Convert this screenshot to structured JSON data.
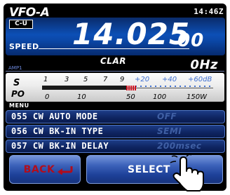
{
  "header": {
    "vfo_label": "VFO-A",
    "time": "14:46Z",
    "mode": "C-U",
    "speed_label": "SPEED",
    "frequency_main": "14.025",
    "frequency_small": "00"
  },
  "clar": {
    "label": "CLAR",
    "amp_label": "AMP1",
    "value": "0Hz"
  },
  "meter": {
    "s_label": "S",
    "po_label": "PO",
    "s_scale": [
      "1",
      "3",
      "5",
      "7",
      "9"
    ],
    "s_scale_over": [
      "+20",
      "+40",
      "+60dB"
    ],
    "po_scale": [
      "0",
      "10",
      "50",
      "100",
      "150W"
    ],
    "level_fraction": 0.55
  },
  "menu": {
    "label": "MENU",
    "items": [
      {
        "name": "055 CW AUTO MODE",
        "value": "OFF"
      },
      {
        "name": "056 CW BK-IN TYPE",
        "value": "SEMI"
      },
      {
        "name": "057 CW BK-IN DELAY",
        "value": "200msec"
      }
    ]
  },
  "buttons": {
    "back_label": "BACK",
    "select_label": "SELECT"
  },
  "icons": {
    "back_arrow": "return-arrow-icon",
    "pointer": "hand-pointer-icon"
  },
  "colors": {
    "accent_blue": "#0c4fb6",
    "back_text": "#b10d1c",
    "meter_red": "#d0121f",
    "inactive_value": "#3f5fa4"
  }
}
